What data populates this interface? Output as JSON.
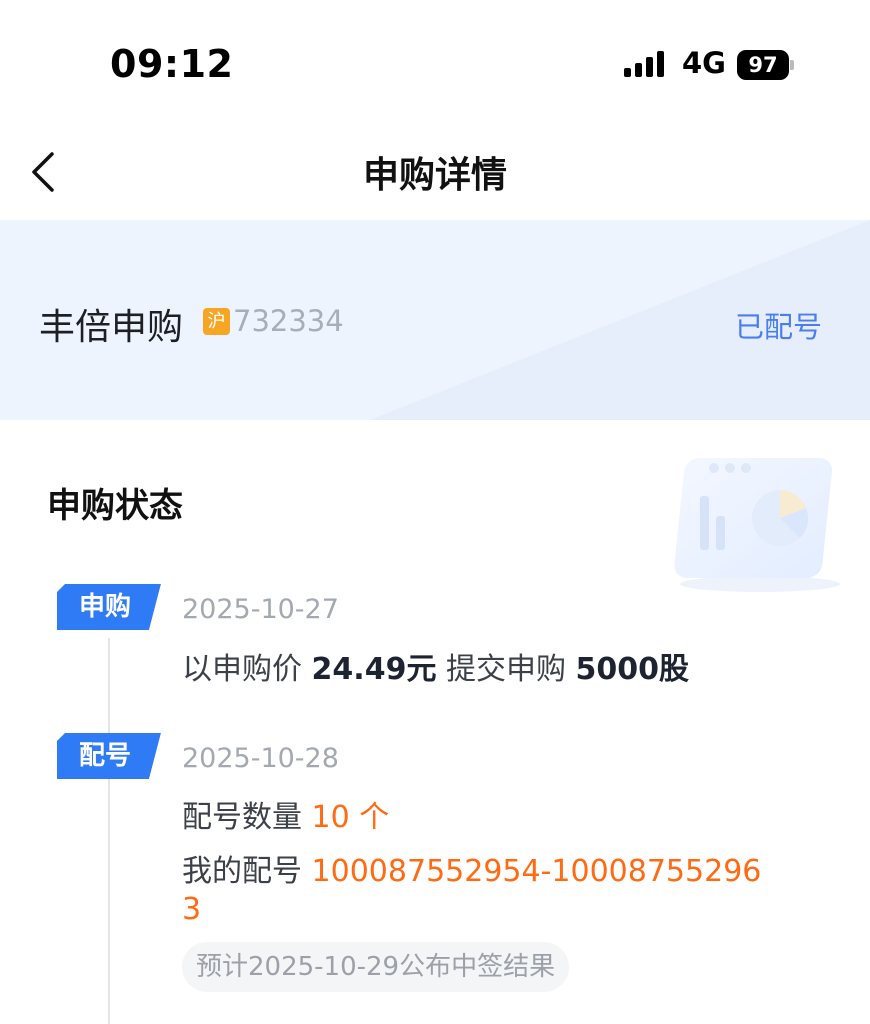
{
  "status_bar": {
    "time": "09:12",
    "network": "4G",
    "battery": "97"
  },
  "nav": {
    "title": "申购详情"
  },
  "stock": {
    "name": "丰倍申购",
    "market_badge": "沪",
    "code": "732334",
    "status": "已配号"
  },
  "section": {
    "title": "申购状态"
  },
  "timeline": [
    {
      "badge": "申购",
      "date": "2025-10-27",
      "line1": {
        "prefix": "以申购价",
        "price": "24.49元",
        "middle": "提交申购",
        "qty": "5000股"
      }
    },
    {
      "badge": "配号",
      "date": "2025-10-28",
      "count": {
        "label": "配号数量",
        "value": "10 个"
      },
      "numbers": {
        "label": "我的配号",
        "value_line1": "100087552954-10008755296",
        "value_line2": "3"
      },
      "note": "预计2025-10-29公布中签结果"
    }
  ],
  "colors": {
    "accent_blue": "#2f7bf5",
    "orange": "#ff6a13",
    "status_blue": "#4a7ef0",
    "badge_yellow": "#f6a623"
  }
}
